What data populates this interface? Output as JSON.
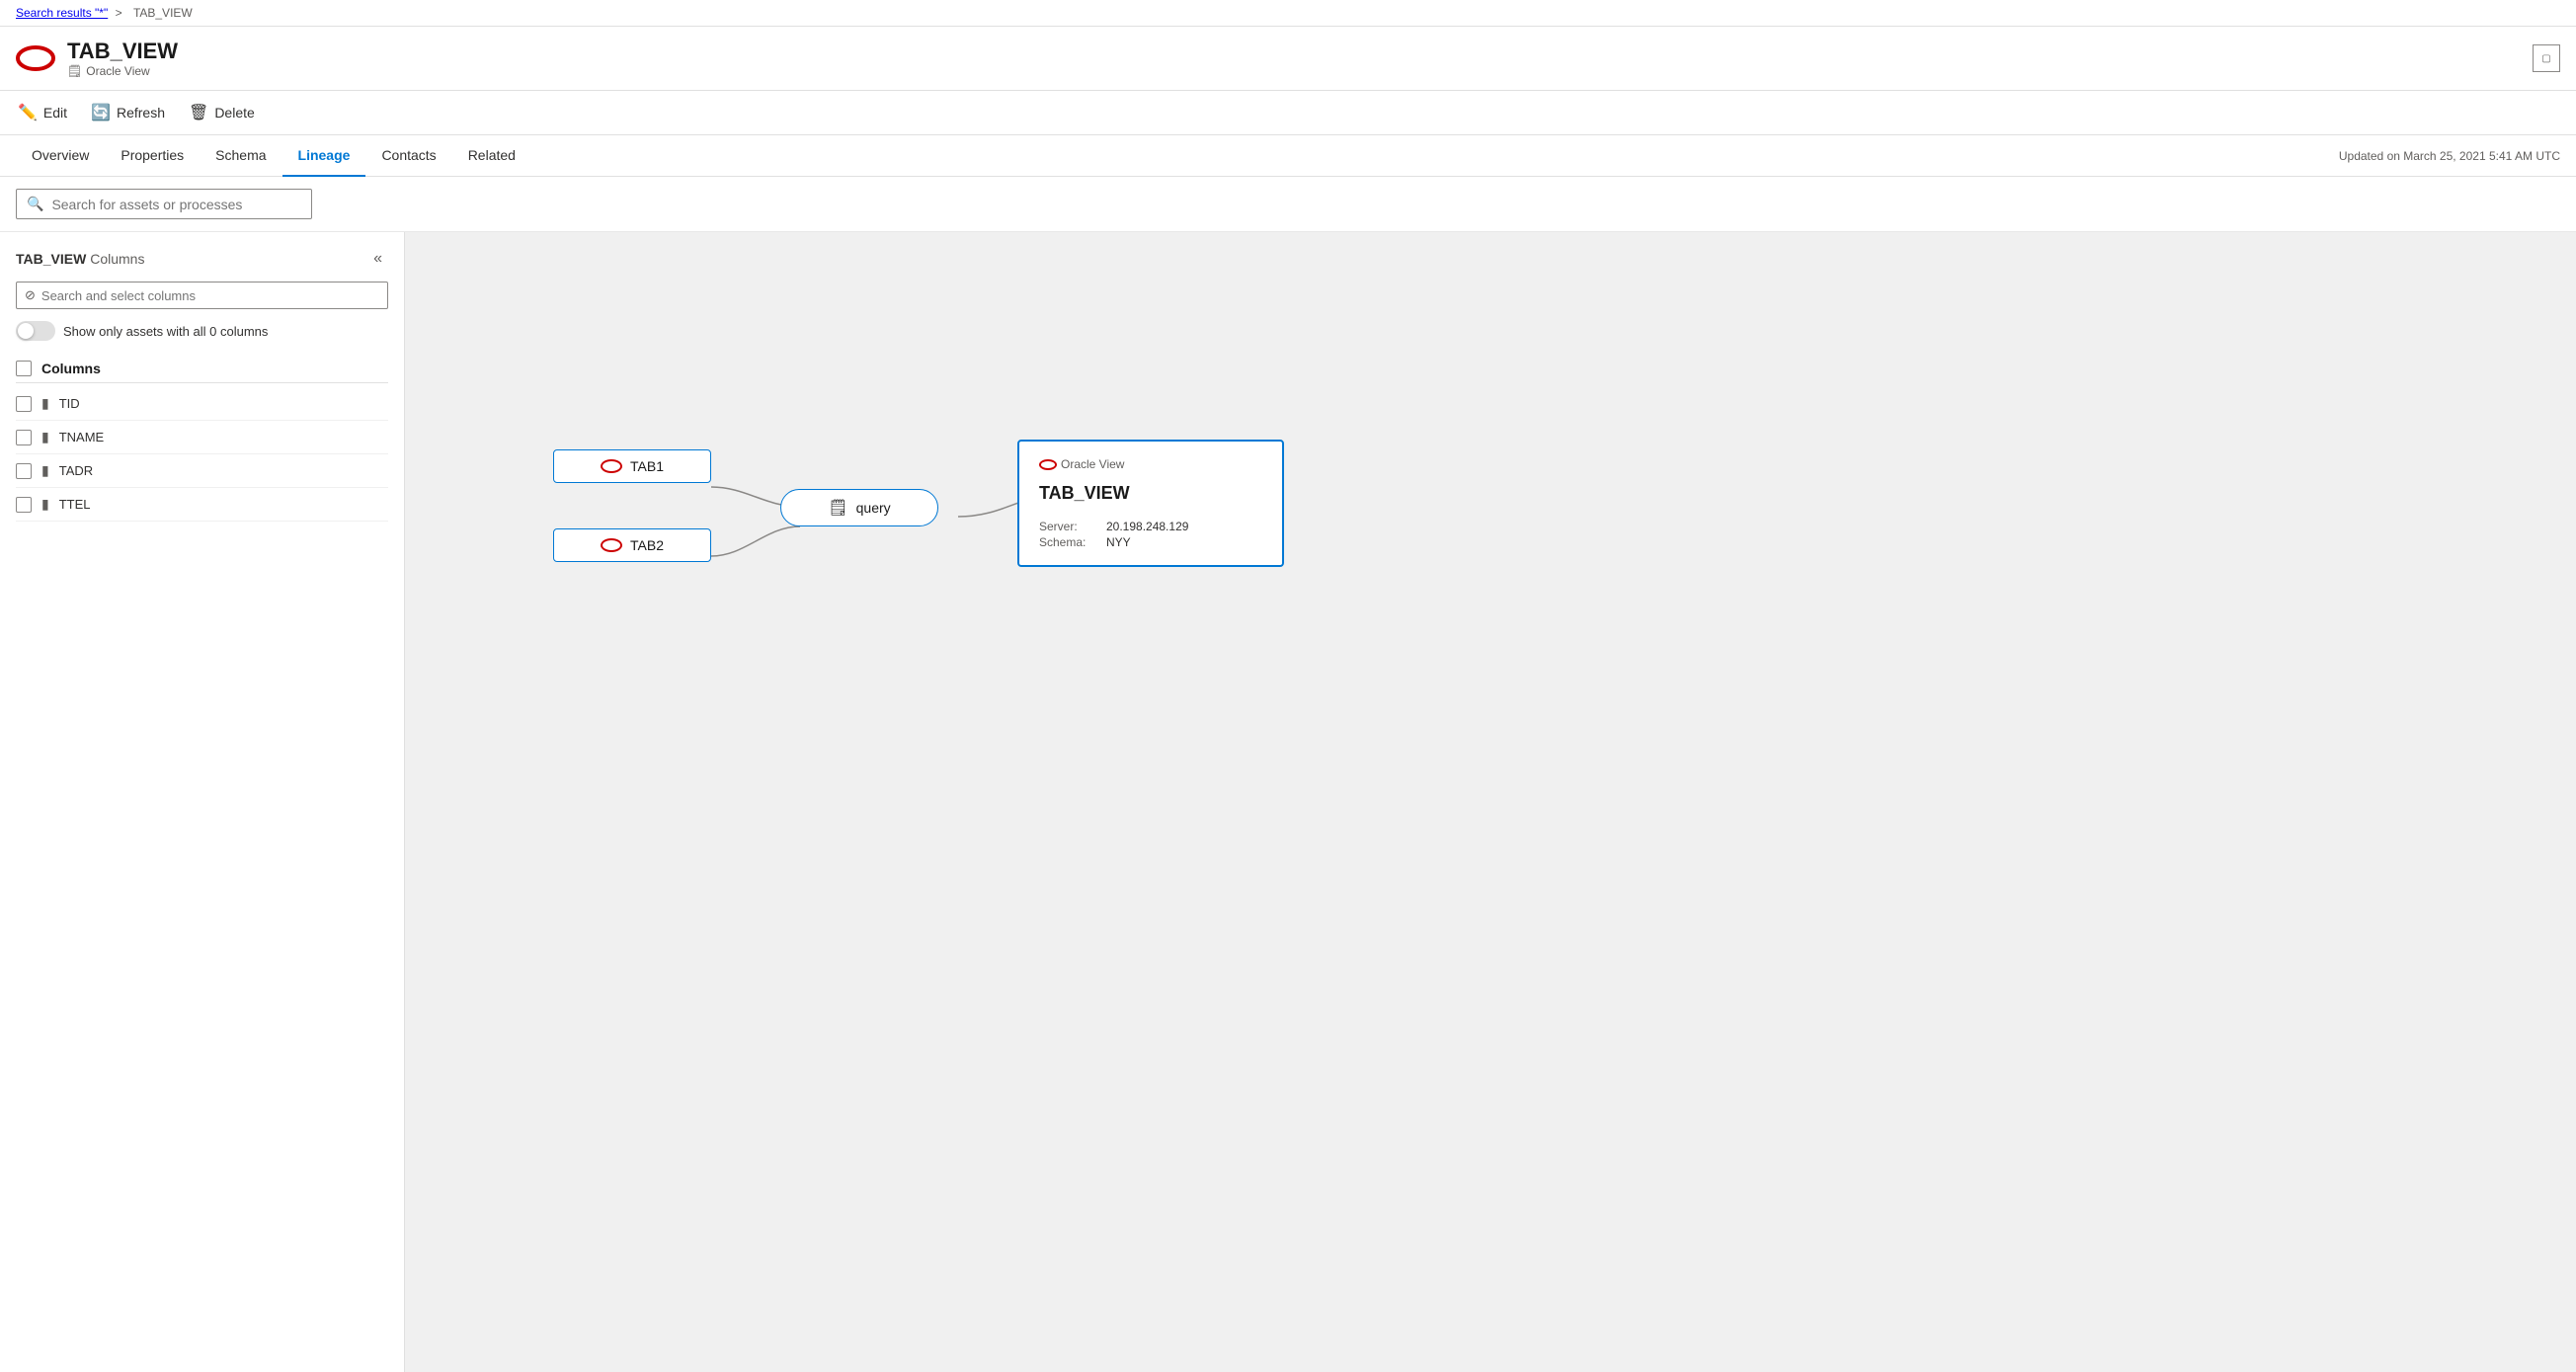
{
  "breadcrumb": {
    "search_label": "Search results \"*\"",
    "separator": ">",
    "current": "TAB_VIEW"
  },
  "header": {
    "title": "TAB_VIEW",
    "subtitle": "Oracle View",
    "expand_label": ""
  },
  "toolbar": {
    "edit_label": "Edit",
    "refresh_label": "Refresh",
    "delete_label": "Delete"
  },
  "tabs": [
    {
      "id": "overview",
      "label": "Overview"
    },
    {
      "id": "properties",
      "label": "Properties"
    },
    {
      "id": "schema",
      "label": "Schema"
    },
    {
      "id": "lineage",
      "label": "Lineage"
    },
    {
      "id": "contacts",
      "label": "Contacts"
    },
    {
      "id": "related",
      "label": "Related"
    }
  ],
  "active_tab": "lineage",
  "updated_label": "Updated on March 25, 2021 5:41 AM UTC",
  "search_assets": {
    "placeholder": "Search for assets or processes"
  },
  "left_panel": {
    "title_bold": "TAB_VIEW",
    "title_normal": "Columns",
    "col_search_placeholder": "Search and select columns",
    "toggle_label": "Show only assets with all 0 columns",
    "columns_header": "Columns",
    "columns": [
      {
        "name": "TID"
      },
      {
        "name": "TNAME"
      },
      {
        "name": "TADR"
      },
      {
        "name": "TTEL"
      }
    ]
  },
  "lineage": {
    "nodes": {
      "tab1": {
        "label": "TAB1"
      },
      "tab2": {
        "label": "TAB2"
      },
      "query": {
        "label": "query"
      },
      "tabview": {
        "type_label": "Oracle View",
        "title": "TAB_VIEW",
        "server_label": "Server:",
        "server_value": "20.198.248.129",
        "schema_label": "Schema:",
        "schema_value": "NYY"
      }
    }
  }
}
